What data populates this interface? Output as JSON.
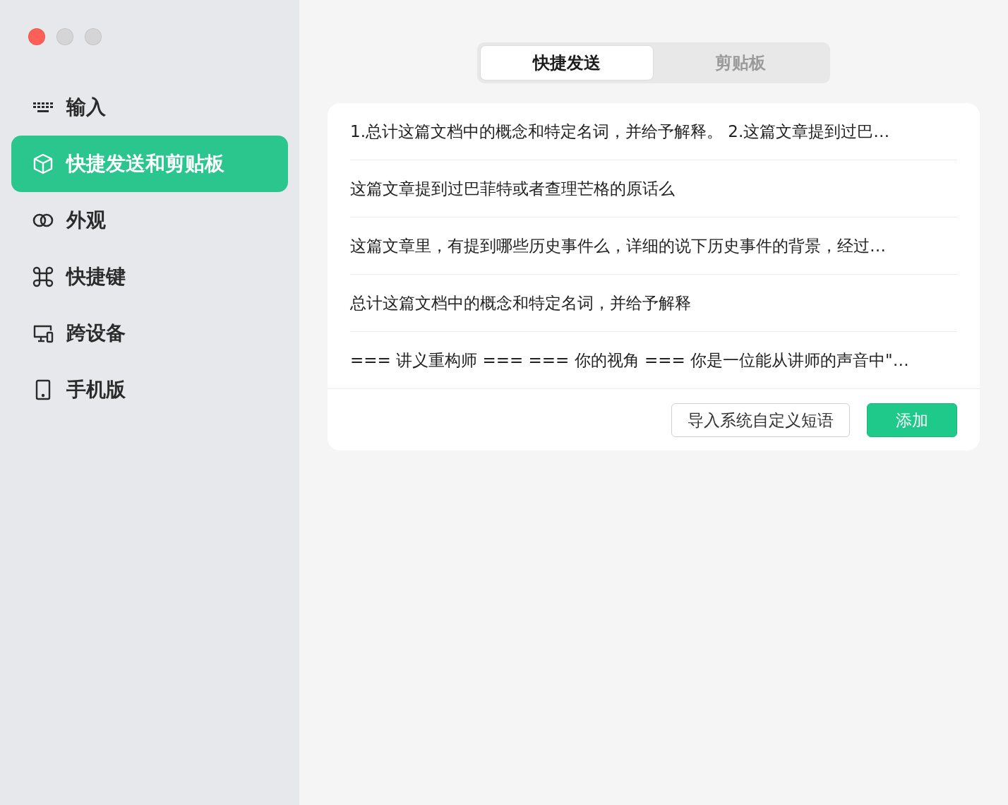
{
  "sidebar": {
    "items": [
      {
        "label": "输入",
        "selected": false
      },
      {
        "label": "快捷发送和剪贴板",
        "selected": true
      },
      {
        "label": "外观",
        "selected": false
      },
      {
        "label": "快捷键",
        "selected": false
      },
      {
        "label": "跨设备",
        "selected": false
      },
      {
        "label": "手机版",
        "selected": false
      }
    ]
  },
  "tabs": [
    {
      "label": "快捷发送",
      "selected": true
    },
    {
      "label": "剪贴板",
      "selected": false
    }
  ],
  "phrases": [
    "1.总计这篇文档中的概念和特定名词，并给予解释。 2.这篇文章提到过巴…",
    "这篇文章提到过巴菲特或者查理芒格的原话么",
    "这篇文章里，有提到哪些历史事件么，详细的说下历史事件的背景，经过…",
    "总计这篇文档中的概念和特定名词，并给予解释",
    "=== 讲义重构师 ===  === 你的视角 ===  你是一位能从讲师的声音中\"…"
  ],
  "buttons": [
    {
      "label": "导入系统自定义短语",
      "kind": "secondary"
    },
    {
      "label": "添加",
      "kind": "primary"
    }
  ]
}
